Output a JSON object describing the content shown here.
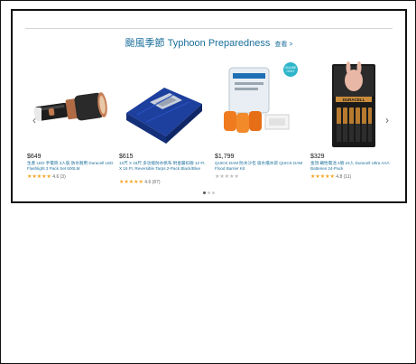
{
  "carousel": {
    "title": "颱風季節 Typhoon Preparedness",
    "see_more": "查看 >",
    "prev_arrow": "‹",
    "next_arrow": "›",
    "products": [
      {
        "price": "$649",
        "name": "生產 LED 手電筒 3入裝 防水耐用 Duracell LED Flashlight 3 Pack Set 600LM",
        "stars": "★★★★★",
        "rating_count": "4.6 (3)",
        "icon": "flashlight-icon"
      },
      {
        "price": "$615",
        "name": "12尺 X 16尺 多功能防水帆布 附金屬扣眼 12 Ft. X 16 Ft. Reversible Tarps 2-Pack Black/Blue",
        "stars": "★★★★★",
        "rating_count": "4.6 (87)",
        "icon": "tarp-icon"
      },
      {
        "price": "$1,799",
        "name": "QUICK DAM 防水沙包 吸水擋水袋 QUICK DAM Flood Barrier Kit",
        "stars": "★★★★★",
        "rating_count": "",
        "icon": "sandbag-kit-icon",
        "badge": "ONLINE ONLY"
      },
      {
        "price": "$329",
        "name": "金頂 鹼性電池 4號 24入 Duracell Ultra AAA Batteries 24-Pack",
        "stars": "★★★★★",
        "rating_count": "4.8 (11)",
        "icon": "battery-pack-icon",
        "pack_text": "DURACELL ULTRA"
      }
    ],
    "dots": 3,
    "active_dot": 1
  }
}
